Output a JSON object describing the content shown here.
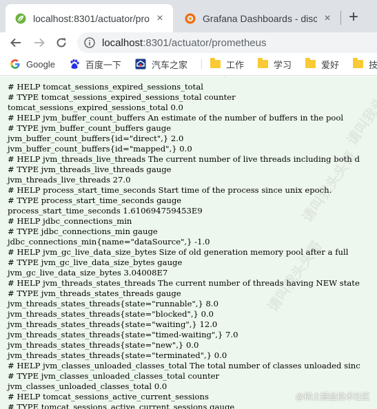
{
  "tabs": [
    {
      "title": "localhost:8301/actuator/prome",
      "close": "×",
      "favicon": "spring-leaf-icon",
      "active": true
    },
    {
      "title": "Grafana Dashboards - discover",
      "close": "×",
      "favicon": "grafana-icon",
      "active": false
    }
  ],
  "newtab_label": "+",
  "address": {
    "host": "localhost",
    "path": ":8301/actuator/prometheus"
  },
  "bookmarks": [
    {
      "label": "Google",
      "icon": "google-icon"
    },
    {
      "label": "百度一下",
      "icon": "baidu-icon"
    },
    {
      "label": "汽车之家",
      "icon": "autohome-icon"
    },
    {
      "label": "工作",
      "icon": "folder-icon"
    },
    {
      "label": "学习",
      "icon": "folder-icon"
    },
    {
      "label": "爱好",
      "icon": "folder-icon"
    },
    {
      "label": "技术",
      "icon": "folder-icon"
    }
  ],
  "metrics_lines": [
    "# HELP tomcat_sessions_expired_sessions_total",
    "# TYPE tomcat_sessions_expired_sessions_total counter",
    "tomcat_sessions_expired_sessions_total 0.0",
    "# HELP jvm_buffer_count_buffers An estimate of the number of buffers in the pool",
    "# TYPE jvm_buffer_count_buffers gauge",
    "jvm_buffer_count_buffers{id=\"direct\",} 2.0",
    "jvm_buffer_count_buffers{id=\"mapped\",} 0.0",
    "# HELP jvm_threads_live_threads The current number of live threads including both d",
    "# TYPE jvm_threads_live_threads gauge",
    "jvm_threads_live_threads 27.0",
    "# HELP process_start_time_seconds Start time of the process since unix epoch.",
    "# TYPE process_start_time_seconds gauge",
    "process_start_time_seconds 1.610694759453E9",
    "# HELP jdbc_connections_min",
    "# TYPE jdbc_connections_min gauge",
    "jdbc_connections_min{name=\"dataSource\",} -1.0",
    "# HELP jvm_gc_live_data_size_bytes Size of old generation memory pool after a full",
    "# TYPE jvm_gc_live_data_size_bytes gauge",
    "jvm_gc_live_data_size_bytes 3.04008E7",
    "# HELP jvm_threads_states_threads The current number of threads having NEW state",
    "# TYPE jvm_threads_states_threads gauge",
    "jvm_threads_states_threads{state=\"runnable\",} 8.0",
    "jvm_threads_states_threads{state=\"blocked\",} 0.0",
    "jvm_threads_states_threads{state=\"waiting\",} 12.0",
    "jvm_threads_states_threads{state=\"timed-waiting\",} 7.0",
    "jvm_threads_states_threads{state=\"new\",} 0.0",
    "jvm_threads_states_threads{state=\"terminated\",} 0.0",
    "# HELP jvm_classes_unloaded_classes_total The total number of classes unloaded sinc",
    "# TYPE jvm_classes_unloaded_classes_total counter",
    "jvm_classes_unloaded_classes_total 0.0",
    "# HELP tomcat_sessions_active_current_sessions",
    "# TYPE tomcat_sessions_active_current_sessions gauge"
  ],
  "watermark_text": "请叫我头头哥",
  "credit_text": "@稀土掘金技术社区",
  "colors": {
    "page_background": "#eef7ee",
    "tabstrip": "#dee1e6",
    "omnibox": "#f1f3f4",
    "folder": "#f9ca35"
  }
}
